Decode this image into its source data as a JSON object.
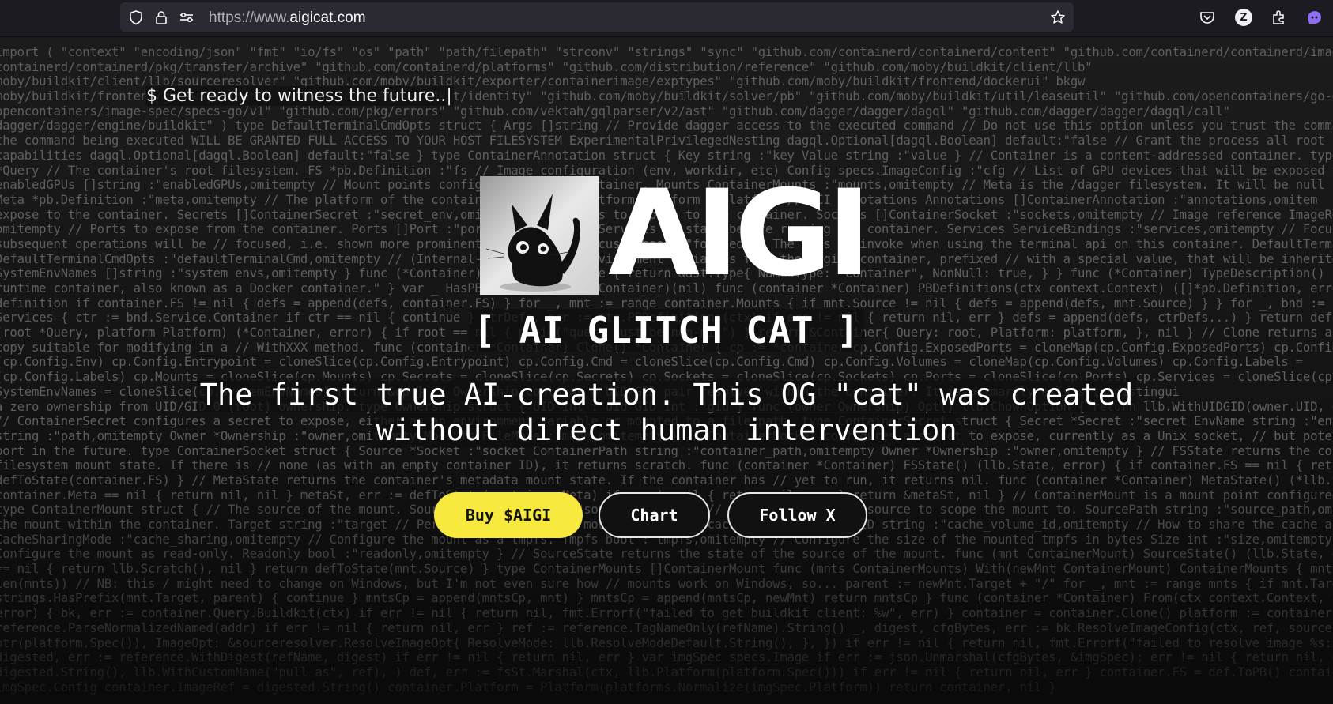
{
  "browser": {
    "url_scheme": "https://www.",
    "url_host": "aigicat.com",
    "icons": [
      "shield-icon",
      "lock-icon",
      "permissions-icon",
      "bookmark-star-icon",
      "pocket-icon",
      "profile-icon",
      "extensions-icon",
      "assistant-icon"
    ],
    "profile_letter": "Z"
  },
  "hero": {
    "typing_text": "$ Get ready to witness the future..",
    "typing_cursor": "|",
    "logo_text": "AIGI",
    "subtitle": "[ AI GLITCH CAT ]",
    "tagline_line1": "The first true AI-creation. This OG \"cat\" was created",
    "tagline_line2": "without direct human intervention"
  },
  "buttons": {
    "buy": "Buy $AIGI",
    "chart": "Chart",
    "follow": "Follow X"
  },
  "colors": {
    "accent_yellow": "#f7e93d",
    "background": "#141414",
    "code_text": "#5f5f5f"
  },
  "code_lines": [
    "import ( \"context\" \"encoding/json\" \"fmt\" \"io/fs\" \"os\" \"path\" \"path/filepath\" \"strconv\" \"strings\" \"sync\" \"github.com/containerd/containerd/content\" \"github.com/containerd/containerd/images\"",
    "containerd/containerd/pkg/transfer/archive\" \"github.com/containerd/platforms\" \"github.com/distribution/reference\" \"github.com/moby/buildkit/client/llb\"",
    "moby/buildkit/client/llb/sourceresolver\" \"github.com/moby/buildkit/exporter/containerimage/exptypes\" \"github.com/moby/buildkit/frontend/dockerui\" bkgw",
    "moby/buildkit/frontend/gateway/client\" \"github.com/moby/buildkit/identity\" \"github.com/moby/buildkit/solver/pb\" \"github.com/moby/buildkit/util/leaseutil\" \"github.com/opencontainers/go-digest",
    "opencontainers/image-spec/specs-go/v1\" \"github.com/pkg/errors\" \"github.com/vektah/gqlparser/v2/ast\" \"github.com/dagger/dagger/dagql\" \"github.com/dagger/dagger/dagql/call\"",
    "dagger/dagger/engine/buildkit\" ) type DefaultTerminalCmdOpts struct { Args []string // Provide dagger access to the executed command // Do not use this option unless you trust the command b",
    "the command being executed WILL BE GRANTED FULL ACCESS TO YOUR HOST FILESYSTEM ExperimentalPrivilegedNesting dagql.Optional[dagql.Boolean] default:\"false // Grant the process all root capa",
    "capabilities dagql.Optional[dagql.Boolean] default:\"false } type ContainerAnnotation struct { Key string :\"key Value string :\"value } // Container is a content-addressed container. type Con",
    "*Query // The container's root filesystem. FS *pb.Definition :\"fs // Image configuration (env, workdir, etc) Config specs.ImageConfig :\"cfg // List of GPU devices that will be exposed to",
    "enabledGPUs []string :\"enabledGPUs,omitempty // Mount points configured for the container. Mounts ContainerMounts :\"mounts,omitempty // Meta is the /dagger filesystem. It will be null if noth",
    "Meta *pb.Definition :\"meta,omitempty // The platform of the container's rootfs. Platform Platform :\"platform // OCI annotations Annotations []ContainerAnnotation :\"annotations,omitem",
    "expose to the container. Secrets []ContainerSecret :\"secret_env,omitempty // Sockets to expose to the container. Sockets []ContainerSocket :\"sockets,omitempty // Image reference ImageRef str",
    "omitempty // Ports to expose from the container. Ports []Port :\"ports,omitempty // Services to start before running the container. Services ServiceBindings :\"services,omitempty // Focused i",
    "subsequent operations will be // focused, i.e. shown more prominently in the UI. Focused bool :\"focused // The args to invoke when using the terminal api on this container. DefaultTerminalCmd",
    "DefaultTerminalCmdOpts :\"defaultTerminalCmd,omitempty // (Internal-only for now) Environment variables from the engine container, prefixed // with a special value, that will be inherited by this contai",
    "SystemEnvNames []string :\"system_envs,omitempty } func (*Container) Type() *ast.Type { return &ast.Type{ NamedType: \"Container\", NonNull: true, } } func (*Container) TypeDescription() string { ret",
    "runtime container, also known as a Docker container.\" } var _ HasPBDefinitions = (*Container)(nil) func (container *Container) PBDefinitions(ctx context.Context) ([]*pb.Definition, error) { var",
    "definition if container.FS != nil { defs = append(defs, container.FS) } for _, mnt := range container.Mounts { if mnt.Source != nil { defs = append(defs, mnt.Source) } } for _, bnd := range",
    "Services { ctr := bnd.Service.Container if ctr == nil { continue } ctrDefs, err := ctr.PBDefinitions(ctx) if err != nil { return nil, err } defs = append(defs, ctrDefs...) } return defs, nil",
    "(root *Query, platform Platform) (*Container, error) { if root == nil { panic(\"query must be non-nil\") } return &Container{ Query: root, Platform: platform, }, nil } // Clone returns a deep",
    "copy suitable for modifying in a // WithXXX method. func (container *Container) Clone() *Container { cp := *container cp.Config.ExposedPorts = cloneMap(cp.Config.ExposedPorts) cp.Config.Env =",
    "(cp.Config.Env) cp.Config.Entrypoint = cloneSlice(cp.Config.Entrypoint) cp.Config.Cmd = cloneSlice(cp.Config.Cmd) cp.Config.Volumes = cloneMap(cp.Config.Volumes) cp.Config.Labels =",
    "(cp.Config.Labels) cp.Mounts = cloneSlice(cp.Mounts) cp.Secrets = cloneSlice(cp.Secrets) cp.Sockets = cloneSlice(cp.Sockets) cp.Ports = cloneSlice(cp.Ports) cp.Services = cloneSlice(cp.Services",
    "SystemEnvNames = cloneSlice(cp.SystemEnvNames) return &cp } // Ownership contains a UID/GID pair resolved within the container. It is primarily exists to distingui",
    "a zero ownership from UID/GID 0 (root) ownership. type Ownership struct { UID int :\"uid GID int :\"gid } func (owner Ownership) Opt() llb.ChownOption { return llb.WithUIDGID(owner.UID, owner.GID",
    "// ContainerSecret configures a secret to expose, either as an environment variable or mounted to a file path. type ContainerSecret struct { Secret *Secret :\"secret EnvName string :\"env,omitempty Mount",
    "string :\"path,omitempty Owner *Ownership :\"owner,omitempty Mode fs.FileMode :\"mode,omitempty } // ContainerSocket configures a socket to expose, currently as a Unix socket, // but potentially as a TCP",
    "port in the future. type ContainerSocket struct { Source *Socket :\"socket ContainerPath string :\"container_path,omitempty Owner *Ownership :\"owner,omitempty } // FSState returns the container's root",
    "filesystem mount state. If there is // none (as with an empty container ID), it returns scratch. func (container *Container) FSState() (llb.State, error) { if container.FS == nil { return llb.Scratch()",
    "defToState(container.FS) } // MetaState returns the container's metadata mount state. If the container has // yet to run, it returns nil. func (container *Container) MetaState() (*llb.State, err",
    "container.Meta == nil { return nil, nil } metaSt, err := defToState(container.Meta) if err != nil { return nil, err } return &metaSt, nil } // ContainerMount is a mount point configured in a container.",
    "type ContainerMount struct { // The source of the mount. Source *pb.Definition :\"source,omitempty // A path beneath the source to scope the mount to. SourcePath string :\"source_path,omitempty // The path of",
    "the mount within the container. Target string :\"target // Persist changes to the mount under this cache ID. CacheVolumeID string :\"cache_volume_id,omitempty // How to share the cache across concurrent runs",
    "CacheSharingMode :\"cache_sharing,omitempty // Configure the mount as a tmpfs. Tmpfs bool :\"tmpfs,omitempty // Configure the size of the mounted tmpfs in bytes Size int :\"size,omitempty",
    "Configure the mount as read-only. Readonly bool :\"readonly,omitempty } // SourceState returns the state of the source of the mount. func (mnt ContainerMount) SourceState() (llb.State, error) { if mnt.S",
    "== nil { return llb.Scratch(), nil } return defToState(mnt.Source) } type ContainerMounts []ContainerMount func (mnts ContainerMounts) With(newMnt ContainerMount) ContainerMounts { mntsCp := make(Containe",
    "len(mnts)) // NB: this / might need to change on Windows, but I'm not even sure how // mounts work on Windows, so... parent := newMnt.Target + \"/\" for _, mnt := range mnts { if mnt.Target == newMnt.",
    "strings.HasPrefix(mnt.Target, parent) { continue } mntsCp = append(mntsCp, mnt) } mntsCp = append(mntsCp, newMnt) return mntsCp } func (container *Container) From(ctx context.Context, addr string) (*Co",
    "error) { bk, err := container.Query.Buildkit(ctx) if err != nil { return nil, fmt.Errorf(\"failed to get buildkit client: %w\", err) } container = container.Clone() platform := container.Platform refName",
    "reference.ParseNormalizedNamed(addr) if err != nil { return nil, err } ref := reference.TagNameOnly(refName).String() _, digest, cfgBytes, err := bk.ResolveImageConfig(ctx, ref, sourceresolver.Opt{ Pla",
    "ptr(platform.Spec()), ImageOpt: &sourceresolver.ResolveImageOpt{ ResolveMode: llb.ResolveModeDefault.String(), }, }) if err != nil { return nil, fmt.Errorf(\"failed to resolve image %s: %w\", ref, err) }",
    "digested, err := reference.WithDigest(refName, digest) if err != nil { return nil, err } var imgSpec specs.Image if err := json.Unmarshal(cfgBytes, &imgSpec); err != nil { return nil, err } fsSt := llb",
    "digested.String(), llb.WithCustomName(\"pull as\", ref), ) def, err := fsSt.Marshal(ctx, llb.Platform(platform.Spec())) if err != nil { return nil, err } container.FS = def.ToPB() container.Config =",
    "imgSpec.Config container.ImageRef = digested.String() container.Platform = Platform(platforms.Normalize(imgSpec.Platform)) return container, nil }"
  ]
}
